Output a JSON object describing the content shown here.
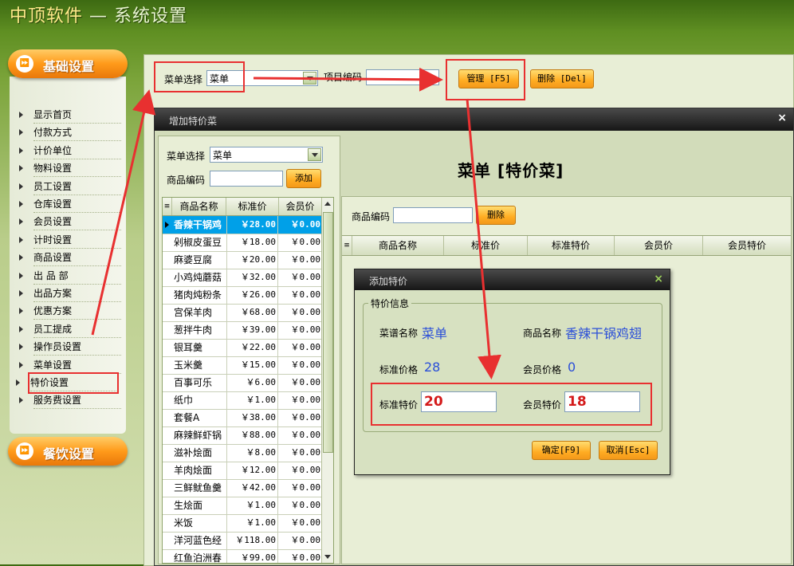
{
  "app": {
    "brand": "中顶软件",
    "title_sep": "—",
    "title": "系统设置"
  },
  "sidebar": {
    "section1": "基础设置",
    "items": [
      {
        "label": "显示首页"
      },
      {
        "label": "付款方式"
      },
      {
        "label": "计价单位"
      },
      {
        "label": "物料设置"
      },
      {
        "label": "员工设置"
      },
      {
        "label": "仓库设置"
      },
      {
        "label": "会员设置"
      },
      {
        "label": "计时设置"
      },
      {
        "label": "商品设置"
      },
      {
        "label": "出 品 部"
      },
      {
        "label": "出品方案"
      },
      {
        "label": "优惠方案"
      },
      {
        "label": "员工提成"
      },
      {
        "label": "操作员设置"
      },
      {
        "label": "菜单设置"
      },
      {
        "label": "特价设置"
      },
      {
        "label": "服务费设置"
      }
    ],
    "selected": "特价设置",
    "section2": "餐饮设置"
  },
  "toolbar": {
    "menu_label": "菜单选择",
    "menu_value": "菜单",
    "code_label": "项目编码",
    "code_value": "",
    "manage_button": "管理 [F5]",
    "delete_button": "删除 [Del]"
  },
  "dialog": {
    "title": "增加特价菜",
    "close": "×",
    "menu_label": "菜单选择",
    "menu_value": "菜单",
    "code_label": "商品编码",
    "code_value": "",
    "add_button": "添加",
    "columns": [
      "商品名称",
      "标准价",
      "会员价"
    ],
    "rows": [
      [
        "香辣干锅鸡",
        "￥28.00",
        "￥0.00"
      ],
      [
        "剁椒皮蛋豆",
        "￥18.00",
        "￥0.00"
      ],
      [
        "麻婆豆腐",
        "￥20.00",
        "￥0.00"
      ],
      [
        "小鸡炖蘑菇",
        "￥32.00",
        "￥0.00"
      ],
      [
        "猪肉炖粉条",
        "￥26.00",
        "￥0.00"
      ],
      [
        "宫保羊肉",
        "￥68.00",
        "￥0.00"
      ],
      [
        "葱拌牛肉",
        "￥39.00",
        "￥0.00"
      ],
      [
        "银耳羹",
        "￥22.00",
        "￥0.00"
      ],
      [
        "玉米羹",
        "￥15.00",
        "￥0.00"
      ],
      [
        "百事可乐",
        "￥6.00",
        "￥0.00"
      ],
      [
        "纸巾",
        "￥1.00",
        "￥0.00"
      ],
      [
        "套餐A",
        "￥38.00",
        "￥0.00"
      ],
      [
        "麻辣鲜虾锅",
        "￥88.00",
        "￥0.00"
      ],
      [
        "滋补烩面",
        "￥8.00",
        "￥0.00"
      ],
      [
        "羊肉烩面",
        "￥12.00",
        "￥0.00"
      ],
      [
        "三鲜鱿鱼羹",
        "￥42.00",
        "￥0.00"
      ],
      [
        "生烩面",
        "￥1.00",
        "￥0.00"
      ],
      [
        "米饭",
        "￥1.00",
        "￥0.00"
      ],
      [
        "洋河蓝色经",
        "￥118.00",
        "￥0.00"
      ],
      [
        "红鱼泊洲春",
        "￥99.00",
        "￥0.00"
      ]
    ],
    "heading": "菜单 [特价菜]",
    "right_code_label": "商品编码",
    "right_code_value": "",
    "right_delete": "删除",
    "right_columns": [
      "商品名称",
      "标准价",
      "标准特价",
      "会员价",
      "会员特价"
    ]
  },
  "special": {
    "title": "添加特价",
    "close": "×",
    "group": "特价信息",
    "menu_name_label": "菜谱名称",
    "menu_name": "菜单",
    "product_label": "商品名称",
    "product": "香辣干锅鸡翅",
    "std_price_label": "标准价格",
    "std_price": "28",
    "mem_price_label": "会员价格",
    "mem_price": "0",
    "std_special_label": "标准特价",
    "std_special": "20",
    "mem_special_label": "会员特价",
    "mem_special": "18",
    "ok": "确定[F9]",
    "cancel": "取消[Esc]"
  },
  "colors": {
    "accent": "#ff9a1a",
    "highlight": "#e83030",
    "selection": "#00a0e8"
  }
}
